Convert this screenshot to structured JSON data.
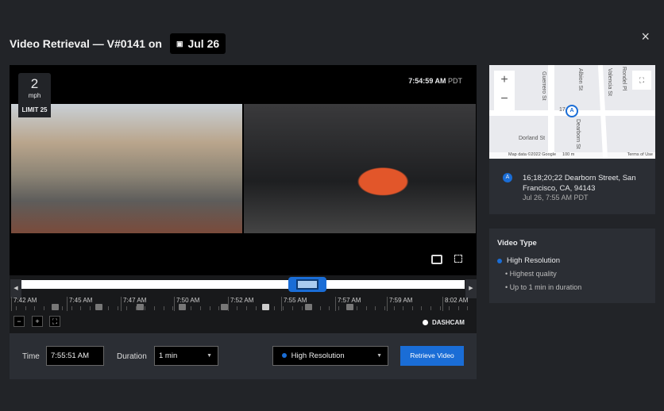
{
  "header": {
    "title": "Video Retrieval — V#0141 on",
    "date": "Jul 26",
    "close": "×"
  },
  "video": {
    "speed": "2",
    "speed_unit": "mph",
    "limit": "LIMIT 25",
    "time": "7:54:59 AM",
    "tz": "PDT"
  },
  "timeline": {
    "labels": [
      "7:42 AM",
      "7:45 AM",
      "7:47 AM",
      "7:50 AM",
      "7:52 AM",
      "7:55 AM",
      "7:57 AM",
      "7:59 AM",
      "8:02 AM"
    ],
    "source": "DASHCAM",
    "zoom_out": "−",
    "zoom_in": "+",
    "fit": "⛶"
  },
  "controls": {
    "time_label": "Time",
    "time_value": "7:55:51 AM",
    "duration_label": "Duration",
    "duration_value": "1 min",
    "resolution": "High Resolution",
    "retrieve": "Retrieve Video"
  },
  "map": {
    "streets": [
      "Guerrero St",
      "Albion St",
      "Valencia St",
      "Rondel Pl",
      "Dorland St",
      "Dearborn St",
      "17"
    ],
    "attribution": "Map data ©2022 Google",
    "scale": "100 m",
    "terms": "Terms of Use",
    "marker": "A"
  },
  "location": {
    "marker": "A",
    "address": "16;18;20;22 Dearborn Street, San Francisco, CA, 94143",
    "time": "Jul 26, 7:55 AM PDT"
  },
  "video_type": {
    "title": "Video Type",
    "selected": "High Resolution",
    "bullets": [
      "Highest quality",
      "Up to 1 min in duration"
    ]
  },
  "colors": {
    "accent": "#1a6dd6",
    "bg": "#222428"
  }
}
